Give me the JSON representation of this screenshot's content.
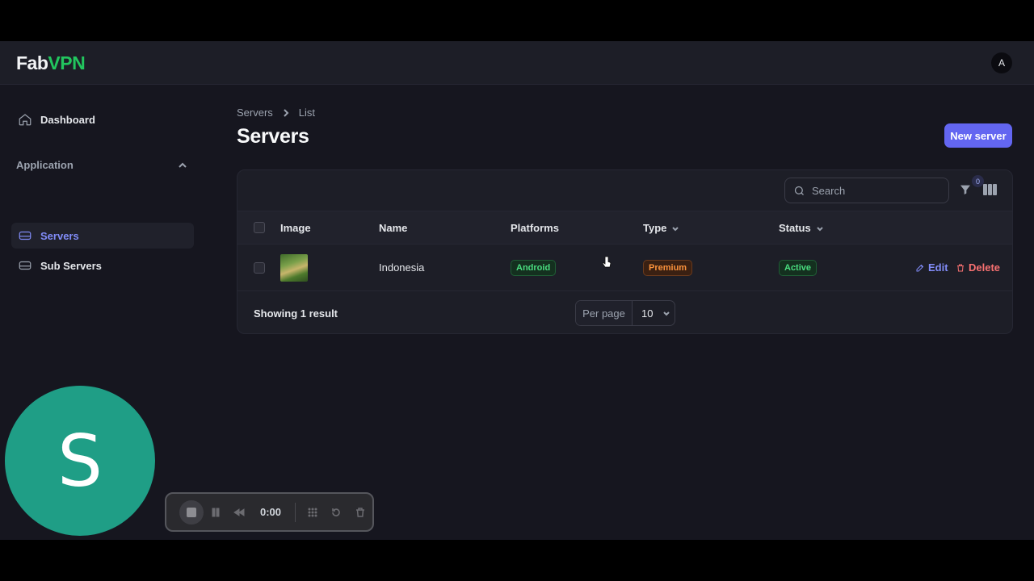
{
  "app": {
    "logo_part1": "Fab",
    "logo_part2": "VPN",
    "user_initial": "A"
  },
  "sidebar": {
    "dashboard": "Dashboard",
    "group_label": "Application",
    "items": [
      {
        "label": "Servers",
        "active": true
      },
      {
        "label": "Sub Servers",
        "active": false
      }
    ]
  },
  "page": {
    "breadcrumb": [
      "Servers",
      "List"
    ],
    "title": "Servers",
    "new_button": "New server"
  },
  "table": {
    "search_placeholder": "Search",
    "filter_count": "0",
    "columns": [
      "Image",
      "Name",
      "Platforms",
      "Type",
      "Status"
    ],
    "rows": [
      {
        "name": "Indonesia",
        "platform": "Android",
        "type": "Premium",
        "status": "Active",
        "edit": "Edit",
        "delete": "Delete"
      }
    ],
    "footer": "Showing 1 result",
    "per_page_label": "Per page",
    "per_page_value": "10"
  },
  "overlay": {
    "webcam_initial": "S",
    "recorder_time": "0:00"
  },
  "colors": {
    "accent": "#6366f1",
    "brand_green": "#22c55e",
    "danger": "#f87171",
    "background": "#16161f"
  }
}
